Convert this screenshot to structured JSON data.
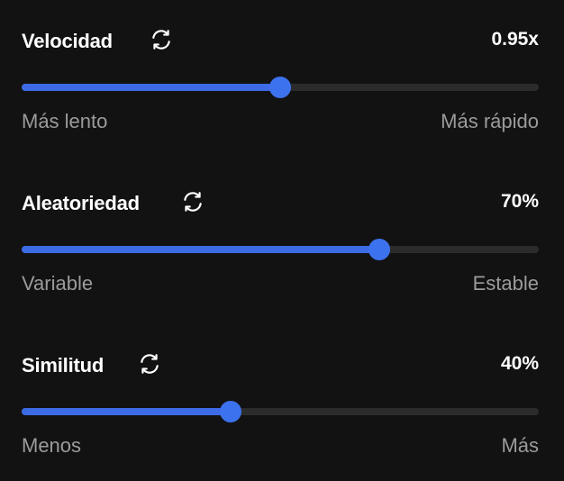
{
  "settings": [
    {
      "title": "Velocidad",
      "value": "0.95x",
      "level": 0.5,
      "min_label": "Más lento",
      "max_label": "Más rápido",
      "reset_icon": "refresh-icon"
    },
    {
      "title": "Aleatoriedad",
      "value": "70%",
      "level": 0.7,
      "min_label": "Variable",
      "max_label": "Estable",
      "reset_icon": "refresh-icon"
    },
    {
      "title": "Similitud",
      "value": "40%",
      "level": 0.4,
      "min_label": "Menos",
      "max_label": "Más",
      "reset_icon": "refresh-icon"
    }
  ],
  "colors": {
    "background": "#121212",
    "accent": "#3d6be6",
    "track": "#2b2b2b",
    "muted_text": "#9b9b9b"
  }
}
